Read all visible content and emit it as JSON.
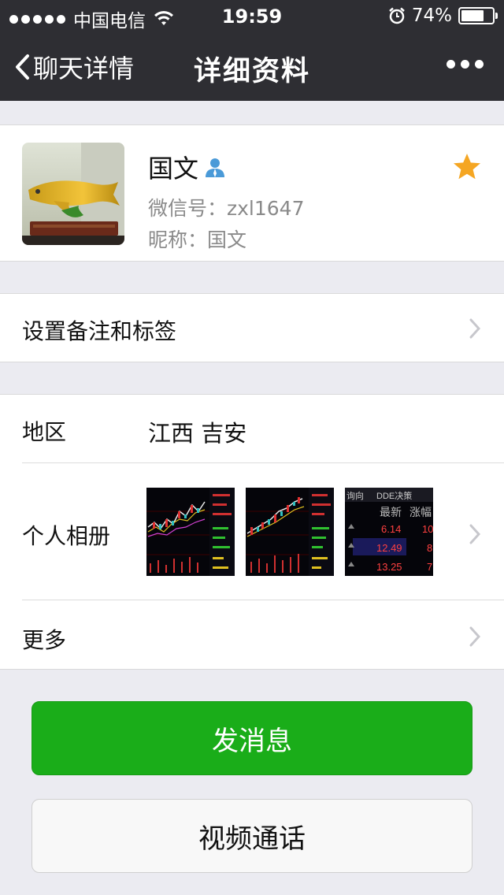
{
  "status_bar": {
    "carrier": "中国电信",
    "time": "19:59",
    "battery": "74%",
    "battery_level": 0.74
  },
  "nav": {
    "back_label": "聊天详情",
    "title": "详细资料",
    "more_icon": "more-dots-icon"
  },
  "profile": {
    "name": "国文",
    "wechat_id": "微信号：zxl1647",
    "nickname": "昵称：国文",
    "contact_icon": "person-icon",
    "starred_icon": "star-icon",
    "star_color": "#f5a623"
  },
  "remark_row": {
    "label": "设置备注和标签"
  },
  "details": {
    "region_label": "地区",
    "region_value": "江西 吉安",
    "album_label": "个人相册",
    "more_label": "更多",
    "album_thumb3": {
      "tab1": "询向",
      "tab2": "DDE决策",
      "col1": "最新",
      "col2": "涨幅",
      "rows": [
        {
          "price": "6.14",
          "change": "10"
        },
        {
          "price": "12.49",
          "change": "8"
        },
        {
          "price": "13.25",
          "change": "7"
        }
      ]
    }
  },
  "actions": {
    "send_message": "发消息",
    "video_call": "视频通话"
  },
  "colors": {
    "nav_bg": "#2e2e33",
    "primary_button": "#1aad19",
    "page_bg": "#ebebf1"
  }
}
